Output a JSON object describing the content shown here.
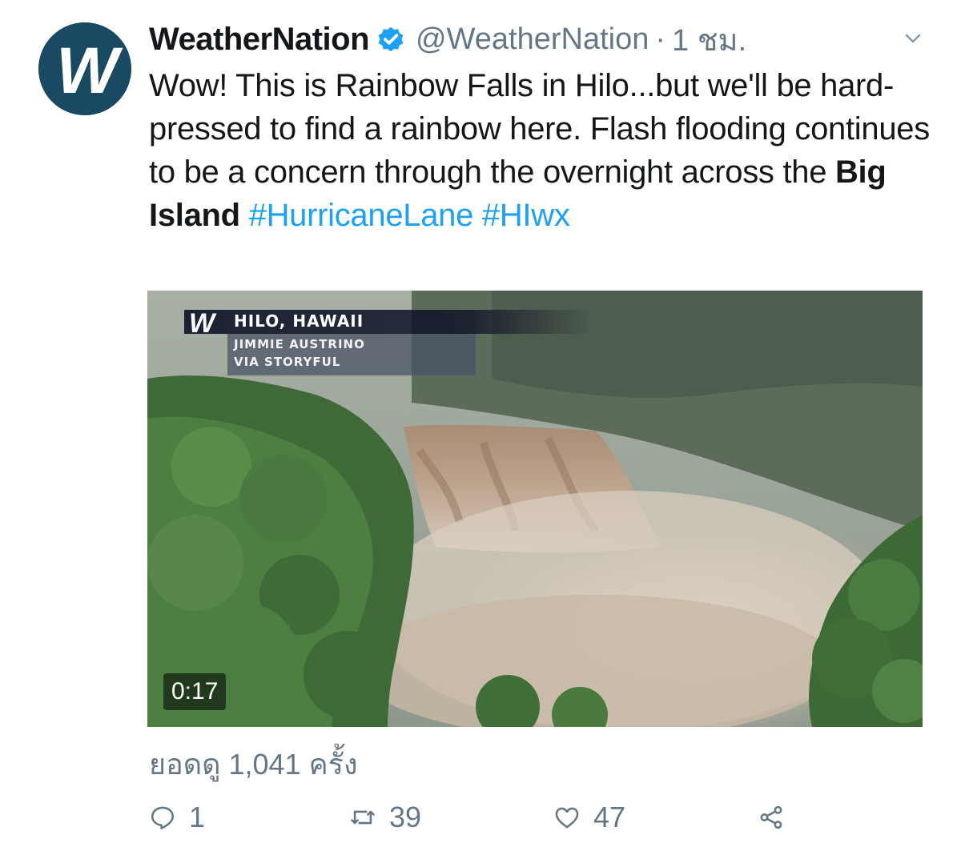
{
  "account": {
    "display_name": "WeatherNation",
    "handle": "@WeatherNation",
    "separator": "·",
    "time": "1 ชม.",
    "verified": true,
    "avatar_letter": "W",
    "avatar_color": "#1a4a63"
  },
  "tweet": {
    "text_plain": "Wow! This is Rainbow Falls in Hilo...but we'll be hard-pressed to find a rainbow here. Flash flooding continues to be a concern through the overnight across the ",
    "text_bold": "Big Island",
    "hashtag_1": "#HurricaneLane",
    "hashtag_2": "#HIwx"
  },
  "media": {
    "type": "video",
    "overlay_logo": "W",
    "overlay_location": "HILO, HAWAII",
    "overlay_credit_1": "JIMMIE AUSTRINO",
    "overlay_credit_2": "VIA STORYFUL",
    "duration": "0:17"
  },
  "views_text": "ยอดดู 1,041 ครั้ง",
  "actions": {
    "reply_count": "1",
    "retweet_count": "39",
    "like_count": "47"
  },
  "colors": {
    "link": "#1da1f2",
    "secondary_text": "#657786",
    "verified_badge": "#1da1f2"
  },
  "icons": {
    "verified": "verified-badge-icon",
    "caret": "chevron-down-icon",
    "reply": "reply-icon",
    "retweet": "retweet-icon",
    "like": "heart-icon",
    "share": "share-icon"
  }
}
